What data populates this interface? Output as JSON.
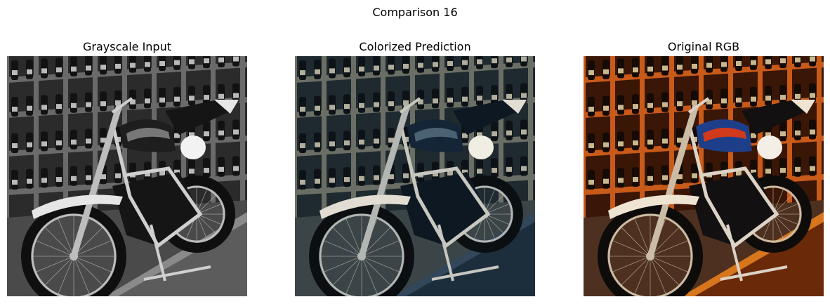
{
  "figure": {
    "title": "Comparison 16"
  },
  "panels": [
    {
      "title": "Grayscale Input",
      "palette": {
        "bg": "#2b2b2b",
        "shelf": "#6a6a6a",
        "shelfDark": "#3a3a3a",
        "bottle": "#121212",
        "label": "#d8d8d8",
        "floor": "#4a4a4a",
        "body": "#151515",
        "fender": "#e6e6e6",
        "frame": "#cfcfcf",
        "tire": "#0f0f0f",
        "rim": "#bdbdbd",
        "plate": "#f2f2f2",
        "counter": "#5c5c5c",
        "counterTop": "#8a8a8a",
        "tank": "#1e1e1e",
        "tankStripe": "#777777"
      }
    },
    {
      "title": "Colorized Prediction",
      "palette": {
        "bg": "#1f2a30",
        "shelf": "#6a6e64",
        "shelfDark": "#2f3a3a",
        "bottle": "#0c1216",
        "label": "#cfcab5",
        "floor": "#3b4548",
        "body": "#0e1822",
        "fender": "#e1ddd2",
        "frame": "#c7c7c0",
        "tire": "#0b0f12",
        "rim": "#b3b6b2",
        "plate": "#f0ede2",
        "counter": "#1c2e3c",
        "counterTop": "#33475a",
        "tank": "#132536",
        "tankStripe": "#4b6272"
      }
    },
    {
      "title": "Original RGB",
      "palette": {
        "bg": "#3a1606",
        "shelf": "#c85a1a",
        "shelfDark": "#7a2a08",
        "bottle": "#140a06",
        "label": "#e9d7a8",
        "floor": "#4d3020",
        "body": "#121010",
        "fender": "#efe4d2",
        "frame": "#dcd3c6",
        "tire": "#0e0c0a",
        "rim": "#cbbca6",
        "plate": "#f4efe6",
        "counter": "#6a2a0a",
        "counterTop": "#d7761c",
        "tank": "#1d3f8a",
        "tankStripe": "#d23a1e"
      }
    }
  ]
}
